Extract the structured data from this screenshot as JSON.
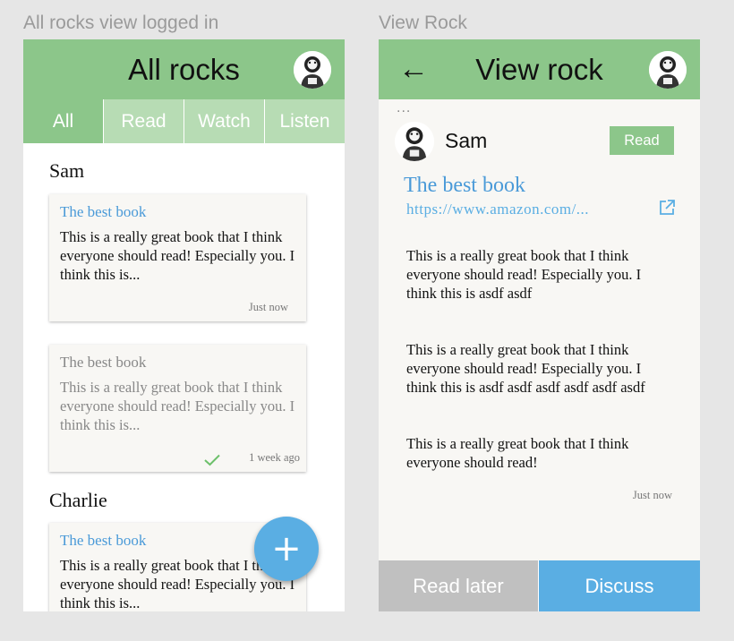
{
  "frames": {
    "left_label": "All rocks view logged in",
    "right_label": "View Rock"
  },
  "all_rocks": {
    "title": "All rocks",
    "tabs": [
      {
        "label": "All",
        "active": true
      },
      {
        "label": "Read",
        "active": false
      },
      {
        "label": "Watch",
        "active": false
      },
      {
        "label": "Listen",
        "active": false
      }
    ],
    "groups": [
      {
        "name": "Sam",
        "cards": [
          {
            "title": "The best book",
            "body": "This is a really great book that I think everyone should read! Especially you. I think this is...",
            "time": "Just now",
            "read": false
          },
          {
            "title": "The best book",
            "body": "This is a really great book that I think everyone should read! Especially you. I think this is...",
            "time": "1 week ago",
            "read": true
          }
        ]
      },
      {
        "name": "Charlie",
        "cards": [
          {
            "title": "The best book",
            "body": "This is a really great book that I think everyone should read! Especially you. I think this is...",
            "time": "",
            "read": false
          }
        ]
      }
    ],
    "fab_label": "+"
  },
  "view_rock": {
    "title": "View rock",
    "back_glyph": "←",
    "more_glyph": "...",
    "poster": "Sam",
    "type_badge": "Read",
    "rock_title": "The best book",
    "url": "https://www.amazon.com/...",
    "paragraphs": [
      "This is a really great book that I think everyone should read! Especially you. I think this is asdf asdf",
      "This is a really great book that I think everyone should read! Especially you. I think this is asdf asdf asdf asdf asdf asdf",
      "This is a really great book that I think everyone should read!"
    ],
    "time": "Just now",
    "read_later_label": "Read later",
    "discuss_label": "Discuss"
  },
  "colors": {
    "appbar": "#8cc68a",
    "tabs_inactive": "#b7dcb4",
    "link_blue": "#4a9ad8",
    "fab_blue": "#5aaee3",
    "read_later_gray": "#c0c0c0",
    "check_green": "#6cc06a"
  },
  "icons": {
    "avatar": "astronaut-avatar-icon",
    "back": "arrow-left-icon",
    "external": "external-link-icon",
    "check": "check-icon",
    "add": "plus-icon"
  }
}
